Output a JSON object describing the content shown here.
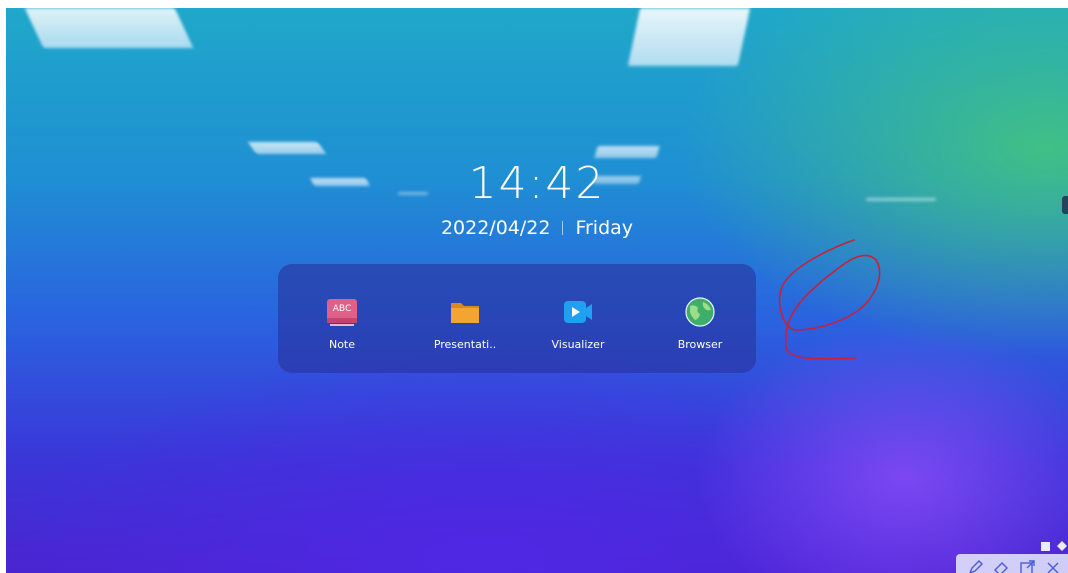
{
  "clock": {
    "time": "14:42",
    "date": "2022/04/22",
    "weekday": "Friday"
  },
  "dock": {
    "apps": [
      {
        "label": "Note",
        "icon": "note-abc-icon",
        "icon_text": "ABC"
      },
      {
        "label": "Presentati..",
        "icon": "folder-icon"
      },
      {
        "label": "Visualizer",
        "icon": "video-camera-icon"
      },
      {
        "label": "Browser",
        "icon": "globe-icon"
      }
    ]
  },
  "toolbar": {
    "tools": [
      "pen-icon",
      "eraser-icon",
      "export-icon",
      "close-icon"
    ]
  },
  "colors": {
    "annotation_ink": "#c8203a",
    "note_icon": "#e0608a",
    "folder_icon": "#f2a530",
    "visualizer_icon": "#1fa0f0",
    "browser_icon": "#3fae6a"
  }
}
